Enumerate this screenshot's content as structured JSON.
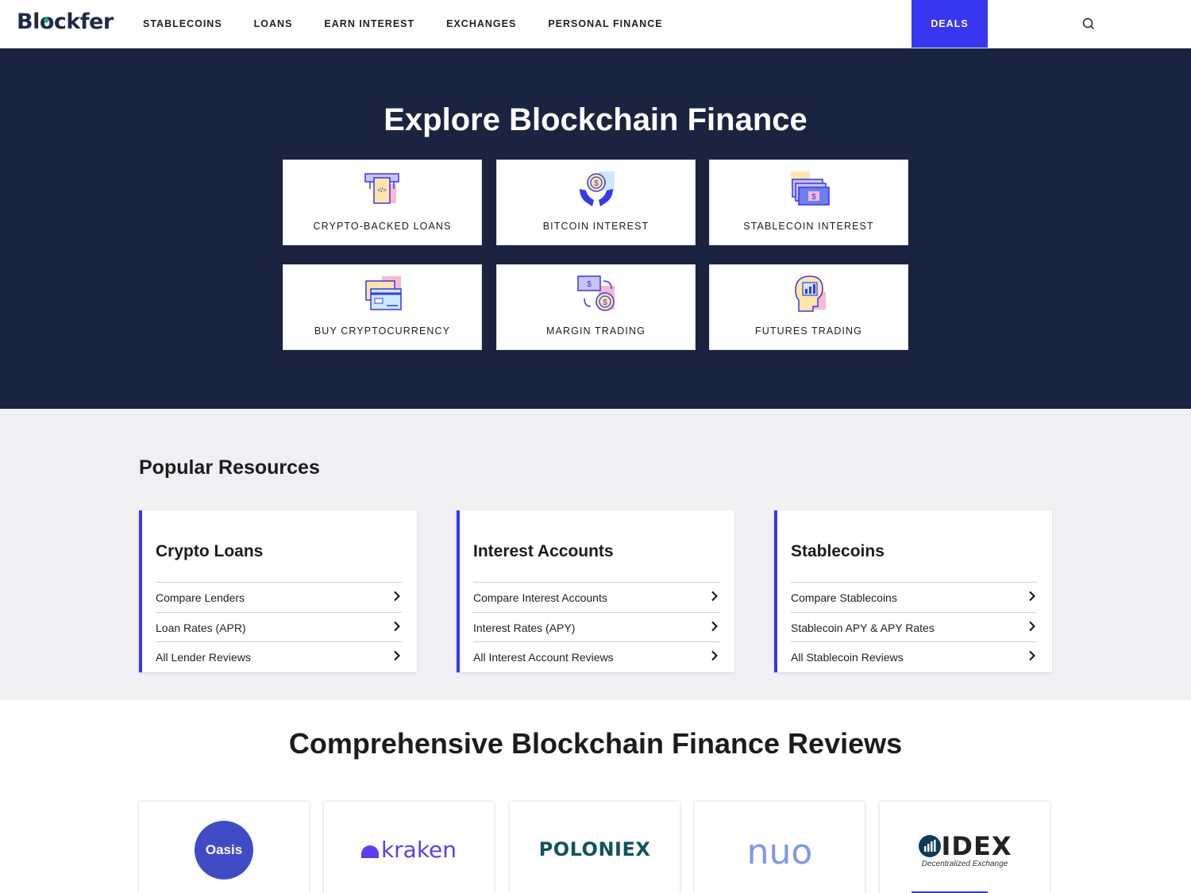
{
  "nav": {
    "logo": "Blockfer",
    "items": [
      "STABLECOINS",
      "LOANS",
      "EARN INTEREST",
      "EXCHANGES",
      "PERSONAL FINANCE"
    ],
    "deals": "DEALS",
    "search_icon": "search-icon"
  },
  "hero": {
    "title": "Explore Blockchain Finance",
    "tiles": [
      {
        "label": "CRYPTO-BACKED LOANS",
        "icon": "atm-icon"
      },
      {
        "label": "BITCOIN INTEREST",
        "icon": "hands-coin-icon"
      },
      {
        "label": "STABLECOIN INTEREST",
        "icon": "cash-stack-icon"
      },
      {
        "label": "BUY CRYPTOCURRENCY",
        "icon": "credit-card-icon"
      },
      {
        "label": "MARGIN TRADING",
        "icon": "exchange-icon"
      },
      {
        "label": "FUTURES TRADING",
        "icon": "head-chart-icon"
      }
    ]
  },
  "popular": {
    "title": "Popular Resources",
    "cards": [
      {
        "title": "Crypto Loans",
        "links": [
          "Compare Lenders",
          "Loan Rates (APR)",
          "All Lender Reviews"
        ]
      },
      {
        "title": "Interest Accounts",
        "links": [
          "Compare Interest Accounts",
          "Interest Rates (APY)",
          "All Interest Account Reviews"
        ]
      },
      {
        "title": "Stablecoins",
        "links": [
          "Compare Stablecoins",
          "Stablecoin APY & APY Rates",
          "All Stablecoin Reviews"
        ]
      }
    ]
  },
  "reviews": {
    "title": "Comprehensive Blockchain Finance Reviews",
    "logos": [
      {
        "name": "Oasis"
      },
      {
        "name": "kraken"
      },
      {
        "name": "POLONIEX"
      },
      {
        "name": "nuo"
      },
      {
        "name": "IDEX",
        "tagline": "Decentralized Exchange"
      }
    ]
  },
  "colors": {
    "accent": "#3737f0",
    "hero_bg": "#1a2340",
    "section_bg": "#f0f0f2"
  }
}
